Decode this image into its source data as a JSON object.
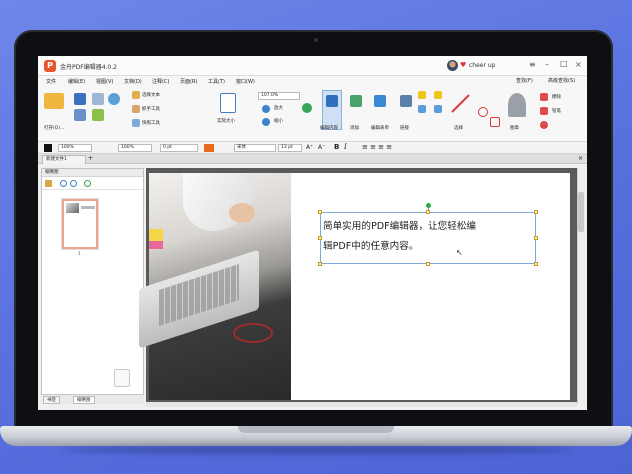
{
  "app": {
    "title": "金舟PDF编辑器4.0.2",
    "logo": "P",
    "user": "cheer up"
  },
  "menu": [
    "文件",
    "编辑(E)",
    "视图(V)",
    "文档(D)",
    "注释(C)",
    "页面(R)",
    "工具(T)",
    "窗口(W)"
  ],
  "menu_right": [
    "查找(F)",
    "高级查找(S)"
  ],
  "ribbon": {
    "open": "打开(O)...",
    "select_text": "选择文本",
    "hand_tool": "抓手工具",
    "snapshot": "快照工具",
    "actual_size": "实际大小",
    "zoom": "107.0%",
    "zoom_in": "放大",
    "zoom_out": "缩小",
    "edit_content": "编辑内容",
    "add": "添加",
    "edit_form": "编辑表单",
    "links": "链接",
    "select": "选择",
    "stamp": "图章",
    "eraser": "擦除",
    "highlight": "高亮",
    "underline": "下划线",
    "pen": "铅笔"
  },
  "format": {
    "zoom": "100%",
    "width": "100%",
    "stroke": "0 pt",
    "font": "宋体",
    "size": "13 pt"
  },
  "tabs": {
    "doc": "新建文件1"
  },
  "thumbnails": {
    "title": "缩略图",
    "page": "1"
  },
  "bottom_tabs": [
    "书签",
    "缩略图"
  ],
  "document": {
    "text_line1": "简单实用的PDF编辑器，让您轻松编",
    "text_line2": "辑PDF中的任意内容。"
  },
  "colors": {
    "accent": "#e8542c",
    "background": "#5a73e0"
  }
}
